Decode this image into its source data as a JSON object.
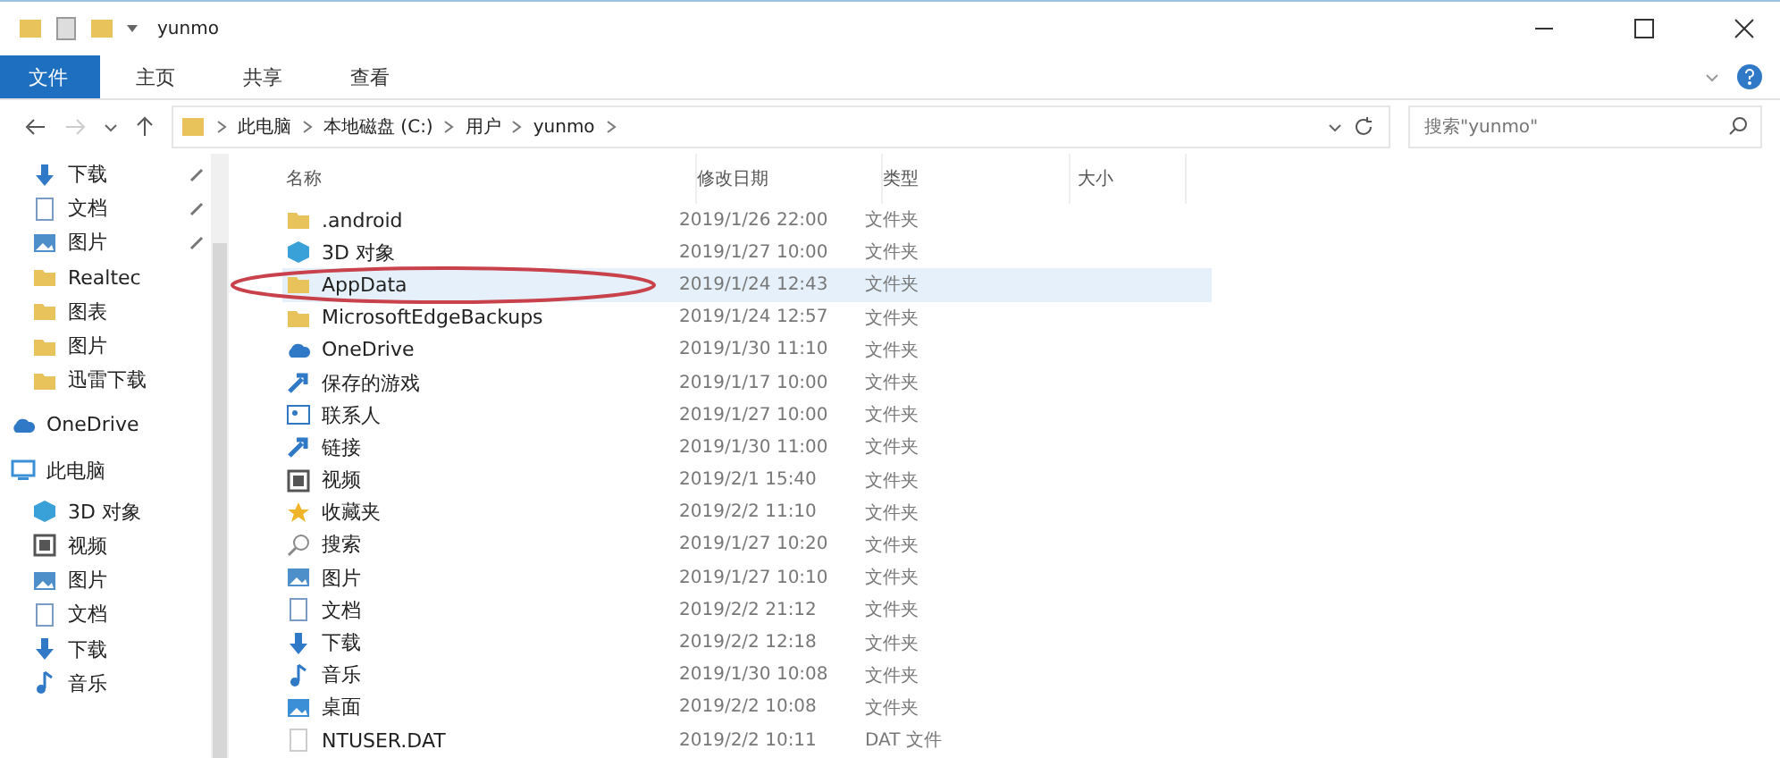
{
  "window": {
    "title": "yunmo"
  },
  "tabs": [
    {
      "label": "文件",
      "selected": true
    },
    {
      "label": "主页",
      "selected": false
    },
    {
      "label": "共享",
      "selected": false
    },
    {
      "label": "查看",
      "selected": false
    }
  ],
  "address": {
    "crumbs": [
      "此电脑",
      "本地磁盘 (C:)",
      "用户",
      "yunmo"
    ]
  },
  "search": {
    "placeholder": "搜索\"yunmo\""
  },
  "sidebar": {
    "items": [
      {
        "label": "下载",
        "kind": "download",
        "pinned": true
      },
      {
        "label": "文档",
        "kind": "doc",
        "pinned": true
      },
      {
        "label": "图片",
        "kind": "picture",
        "pinned": true
      },
      {
        "label": "Realtec",
        "kind": "folder",
        "pinned": false
      },
      {
        "label": "图表",
        "kind": "folder",
        "pinned": false
      },
      {
        "label": "图片",
        "kind": "folder",
        "pinned": false
      },
      {
        "label": "迅雷下载",
        "kind": "folder",
        "pinned": false
      },
      {
        "label": "OneDrive",
        "kind": "cloud",
        "pinned": false
      },
      {
        "label": "此电脑",
        "kind": "pc",
        "pinned": false
      },
      {
        "label": "3D 对象",
        "kind": "cube",
        "pinned": false
      },
      {
        "label": "视频",
        "kind": "video",
        "pinned": false
      },
      {
        "label": "图片",
        "kind": "picture",
        "pinned": false
      },
      {
        "label": "文档",
        "kind": "doc",
        "pinned": false
      },
      {
        "label": "下载",
        "kind": "download",
        "pinned": false
      },
      {
        "label": "音乐",
        "kind": "music",
        "pinned": false
      }
    ]
  },
  "table": {
    "columns": [
      "名称",
      "修改日期",
      "类型",
      "大小"
    ],
    "rows": [
      {
        "name": ".android",
        "date": "2019/1/26 22:00",
        "type": "文件夹",
        "kind": "folder",
        "selected": false
      },
      {
        "name": "3D 对象",
        "date": "2019/1/27 10:00",
        "type": "文件夹",
        "kind": "cube",
        "selected": false
      },
      {
        "name": "AppData",
        "date": "2019/1/24 12:43",
        "type": "文件夹",
        "kind": "folder",
        "selected": true
      },
      {
        "name": "MicrosoftEdgeBackups",
        "date": "2019/1/24 12:57",
        "type": "文件夹",
        "kind": "folder",
        "selected": false
      },
      {
        "name": "OneDrive",
        "date": "2019/1/30 11:10",
        "type": "文件夹",
        "kind": "cloud",
        "selected": false
      },
      {
        "name": "保存的游戏",
        "date": "2019/1/17 10:00",
        "type": "文件夹",
        "kind": "arrow",
        "selected": false
      },
      {
        "name": "联系人",
        "date": "2019/1/27 10:00",
        "type": "文件夹",
        "kind": "contacts",
        "selected": false
      },
      {
        "name": "链接",
        "date": "2019/1/30 11:00",
        "type": "文件夹",
        "kind": "arrow",
        "selected": false
      },
      {
        "name": "视频",
        "date": "2019/2/1 15:40",
        "type": "文件夹",
        "kind": "video",
        "selected": false
      },
      {
        "name": "收藏夹",
        "date": "2019/2/2 11:10",
        "type": "文件夹",
        "kind": "star",
        "selected": false
      },
      {
        "name": "搜索",
        "date": "2019/1/27 10:20",
        "type": "文件夹",
        "kind": "search",
        "selected": false
      },
      {
        "name": "图片",
        "date": "2019/1/27 10:10",
        "type": "文件夹",
        "kind": "picture",
        "selected": false
      },
      {
        "name": "文档",
        "date": "2019/2/2 21:12",
        "type": "文件夹",
        "kind": "doc",
        "selected": false
      },
      {
        "name": "下载",
        "date": "2019/2/2 12:18",
        "type": "文件夹",
        "kind": "download",
        "selected": false
      },
      {
        "name": "音乐",
        "date": "2019/1/30 10:08",
        "type": "文件夹",
        "kind": "music",
        "selected": false
      },
      {
        "name": "桌面",
        "date": "2019/2/2 10:08",
        "type": "文件夹",
        "kind": "desktop",
        "selected": false
      },
      {
        "name": "NTUSER.DAT",
        "date": "2019/2/2 10:11",
        "type": "DAT 文件",
        "kind": "file",
        "selected": false
      }
    ]
  }
}
